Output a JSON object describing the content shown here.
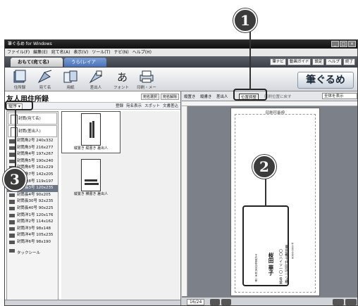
{
  "window": {
    "title": "筆ぐるめ for Windows",
    "menus": [
      "ファイル(F)",
      "編集(E)",
      "宛て名(A)",
      "表示(V)",
      "ツール(T)",
      "ナビ(N)",
      "ヘルプ(H)"
    ],
    "controls": [
      "_",
      "□",
      "×"
    ]
  },
  "mode_tabs": {
    "omote": "おもて(宛て名)",
    "ura": "うら(レイアウト)へ切替"
  },
  "top_buttons": [
    "筆ナビ",
    "動画ガイド",
    "設定",
    "ヘルプ",
    "終了"
  ],
  "toolbar": {
    "tools": [
      {
        "label": "住所録",
        "icon": "address-book-icon"
      },
      {
        "label": "宛て名",
        "icon": "recipient-icon"
      },
      {
        "label": "用紙",
        "icon": "paper-icon"
      },
      {
        "label": "差出人",
        "icon": "sender-icon"
      },
      {
        "label": "フォント",
        "icon": "font-icon"
      },
      {
        "label": "印刷・メール",
        "icon": "print-mail-icon"
      }
    ],
    "brand": "筆ぐるめ"
  },
  "left_pane": {
    "title": "友人用住所録",
    "title_buttons": [
      "宛名選択",
      "宛名解除"
    ],
    "dropdown": "縦序",
    "sub_options": [
      "登録",
      "宛名表示",
      "スポット",
      "文書差込"
    ],
    "envelope_list": [
      {
        "label": "封筒(宛て名)",
        "kind": "big"
      },
      {
        "label": "封筒(差出人)",
        "kind": "big"
      },
      {
        "label": "封筒角2号 240x332",
        "kind": "item"
      },
      {
        "label": "封筒角3号 216x277",
        "kind": "item"
      },
      {
        "label": "封筒角4号 197x267",
        "kind": "item"
      },
      {
        "label": "封筒角5号 190x240",
        "kind": "item"
      },
      {
        "label": "封筒角6号 162x229",
        "kind": "item"
      },
      {
        "label": "封筒角7号 142x205",
        "kind": "item"
      },
      {
        "label": "封筒角8号 119x197",
        "kind": "item"
      },
      {
        "label": "封筒長3号 120x235",
        "kind": "selected"
      },
      {
        "label": "封筒長4号 90x205",
        "kind": "item"
      },
      {
        "label": "封筒長30号 92x235",
        "kind": "item"
      },
      {
        "label": "封筒長40号 90x225",
        "kind": "item"
      },
      {
        "label": "封筒洋1号 120x176",
        "kind": "item"
      },
      {
        "label": "封筒洋2号 114x162",
        "kind": "item"
      },
      {
        "label": "封筒洋3号 98x148",
        "kind": "item"
      },
      {
        "label": "封筒洋4号 105x235",
        "kind": "item"
      },
      {
        "label": "封筒洋6号 98x190",
        "kind": "item"
      },
      {
        "label": "タックシール",
        "kind": "last"
      }
    ],
    "thumbs": [
      {
        "caption": "縦置き 縦書き 差出人"
      },
      {
        "caption": "縦置き 横書き 差出人"
      }
    ]
  },
  "right_pane": {
    "tabs": [
      "縦置き",
      "縦書き",
      "差出人",
      "位置調整",
      "印刷位置に戻す"
    ],
    "view_select": "全体を表示",
    "paper_label": "印刷可能枠",
    "address": {
      "postal": "〒000-0000",
      "line1": "東京都千代田区一ツ橋",
      "line2": "〇〇ハイツ一〇一号室",
      "name": "桜田 華子",
      "sender": "千代田区丸の内 鈴木一郎"
    },
    "page_indicator": "16/24"
  },
  "callouts": [
    "1",
    "2",
    "3"
  ]
}
